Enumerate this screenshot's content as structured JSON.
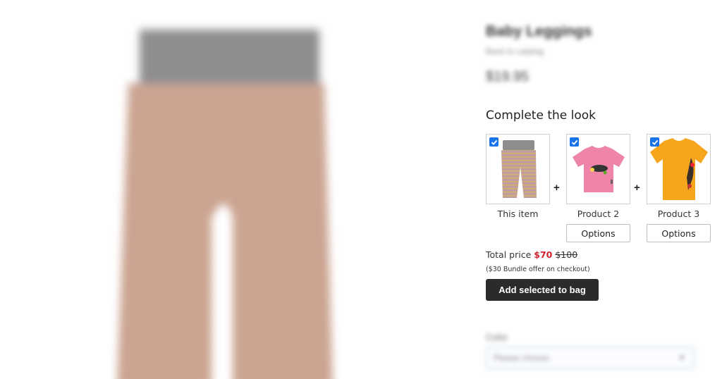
{
  "product": {
    "title": "Baby Leggings",
    "back_link": "Back to catalog",
    "price": "$19.95"
  },
  "bundle": {
    "heading": "Complete the look",
    "items": [
      {
        "label": "This item",
        "checked": true,
        "has_options": false
      },
      {
        "label": "Product 2",
        "checked": true,
        "has_options": true,
        "options_label": "Options"
      },
      {
        "label": "Product 3",
        "checked": true,
        "has_options": true,
        "options_label": "Options"
      }
    ],
    "total_label": "Total price",
    "total_sale": "$70",
    "total_original": "$100",
    "note": "($30 Bundle offer on checkout)",
    "add_button": "Add selected to bag"
  },
  "variant": {
    "color_label": "Color",
    "color_placeholder": "Please choose"
  },
  "icons": {
    "check": "check-icon",
    "plus": "plus-icon",
    "chevron": "chevron-down-icon"
  },
  "colors": {
    "accent": "#1a73e8",
    "sale": "#d2222d",
    "button_bg": "#2b2b2b"
  }
}
